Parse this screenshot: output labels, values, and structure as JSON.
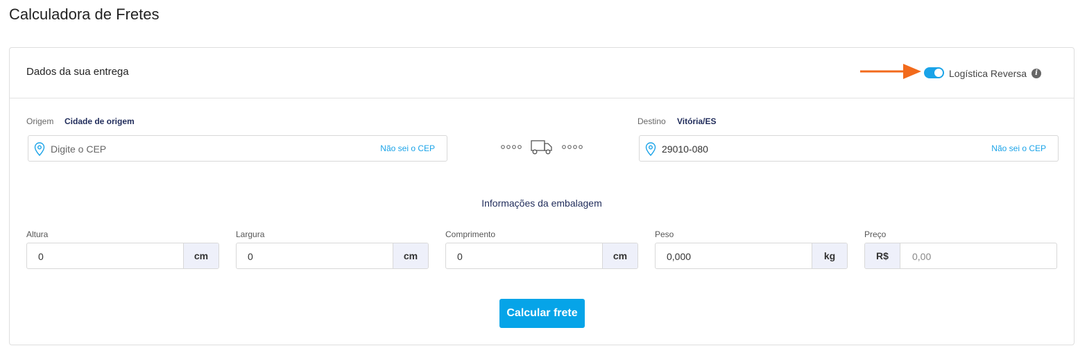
{
  "page": {
    "title": "Calculadora de Fretes"
  },
  "card": {
    "title": "Dados da sua entrega",
    "reverse_logistics": {
      "label": "Logística Reversa",
      "enabled": true,
      "info_icon": "info-icon"
    }
  },
  "origin": {
    "label": "Origem",
    "city": "Cidade de origem",
    "cep_value": "",
    "cep_placeholder": "Digite o CEP",
    "link": "Não sei o CEP"
  },
  "destination": {
    "label": "Destino",
    "city": "Vitória/ES",
    "cep_value": "29010-080",
    "cep_placeholder": "Digite o CEP",
    "link": "Não sei o CEP"
  },
  "package": {
    "title": "Informações da embalagem",
    "fields": [
      {
        "label": "Altura",
        "value": "0",
        "unit": "cm"
      },
      {
        "label": "Largura",
        "value": "0",
        "unit": "cm"
      },
      {
        "label": "Comprimento",
        "value": "0",
        "unit": "cm"
      },
      {
        "label": "Peso",
        "value": "0,000",
        "unit": "kg"
      },
      {
        "label": "Preço",
        "value": "",
        "placeholder": "0,00",
        "unit": "R$"
      }
    ]
  },
  "actions": {
    "calculate": "Calcular frete"
  },
  "colors": {
    "accent": "#06a4e8",
    "arrow": "#f26a1b",
    "navy": "#1f2b5a"
  }
}
